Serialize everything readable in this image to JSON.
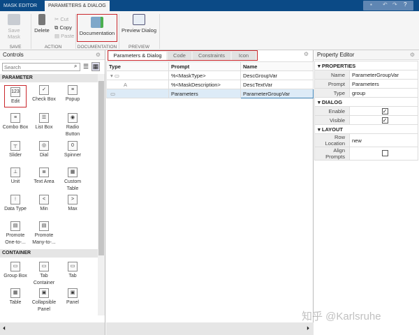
{
  "tabs": {
    "mask_editor": "MASK EDITOR",
    "params_dialog": "PARAMETERS & DIALOG"
  },
  "toolstrip": {
    "save_mask": "Save Mask",
    "delete": "Delete",
    "cut": "Cut",
    "copy": "Copy",
    "paste": "Paste",
    "documentation": "Documentation",
    "preview_dialog": "Preview Dialog",
    "sections": [
      "SAVE",
      "ACTION",
      "DOCUMENTATION",
      "PREVIEW"
    ]
  },
  "controls": {
    "title": "Controls",
    "search_placeholder": "Search",
    "parameter_header": "PARAMETER",
    "container_header": "CONTAINER",
    "parameter_items": [
      {
        "label": "Edit",
        "glyph": "123"
      },
      {
        "label": "Check Box",
        "glyph": "✓"
      },
      {
        "label": "Popup",
        "glyph": "≡"
      },
      {
        "label": "Combo Box",
        "glyph": "≡"
      },
      {
        "label": "List Box",
        "glyph": "☰"
      },
      {
        "label": "Radio Button",
        "glyph": "◉"
      },
      {
        "label": "Slider",
        "glyph": "┬"
      },
      {
        "label": "Dial",
        "glyph": "◎"
      },
      {
        "label": "Spinner",
        "glyph": "0"
      },
      {
        "label": "Unit",
        "glyph": "⊥"
      },
      {
        "label": "Text Area",
        "glyph": "≣"
      },
      {
        "label": "Custom Table",
        "glyph": "▦"
      },
      {
        "label": "Data Type",
        "glyph": "⁝"
      },
      {
        "label": "Min",
        "glyph": "<"
      },
      {
        "label": "Max",
        "glyph": ">"
      },
      {
        "label": "Promote One-to-...",
        "glyph": "▤"
      },
      {
        "label": "Promote Many-to-...",
        "glyph": "▤"
      }
    ],
    "container_items": [
      {
        "label": "Group Box",
        "glyph": "▭"
      },
      {
        "label": "Tab Container",
        "glyph": "▭"
      },
      {
        "label": "Tab",
        "glyph": "▭"
      },
      {
        "label": "Table",
        "glyph": "▦"
      },
      {
        "label": "Collapsible Panel",
        "glyph": "▣"
      },
      {
        "label": "Panel",
        "glyph": "▣"
      }
    ]
  },
  "center": {
    "tabs": [
      "Parameters & Dialog",
      "Code",
      "Constraints",
      "Icon"
    ],
    "columns": [
      "Type",
      "Prompt",
      "Name"
    ],
    "rows": [
      {
        "type": "▾ ▭",
        "prompt": "%<MaskType>",
        "name": "DescGroupVar"
      },
      {
        "type": "A",
        "prompt": "%<MaskDescription>",
        "name": "DescTextVar"
      },
      {
        "type": "▭",
        "prompt": "Parameters",
        "name": "ParameterGroupVar"
      }
    ]
  },
  "property_editor": {
    "title": "Property Editor",
    "properties": {
      "header": "PROPERTIES",
      "name_label": "Name",
      "name": "ParameterGroupVar",
      "prompt_label": "Prompt",
      "prompt": "Parameters",
      "type_label": "Type",
      "type": "group"
    },
    "dialog": {
      "header": "DIALOG",
      "enable_label": "Enable",
      "enable": true,
      "visible_label": "Visible",
      "visible": true
    },
    "layout": {
      "header": "LAYOUT",
      "row_location_label": "Row Location",
      "row_location": "new",
      "align_prompts_label": "Align Prompts",
      "align_prompts": false
    }
  },
  "watermark": "知乎 @Karlsruhe",
  "colors": {
    "title_bar": "#0b4a86",
    "highlight": "#c9262b",
    "selected_row": "#ddebf7"
  }
}
